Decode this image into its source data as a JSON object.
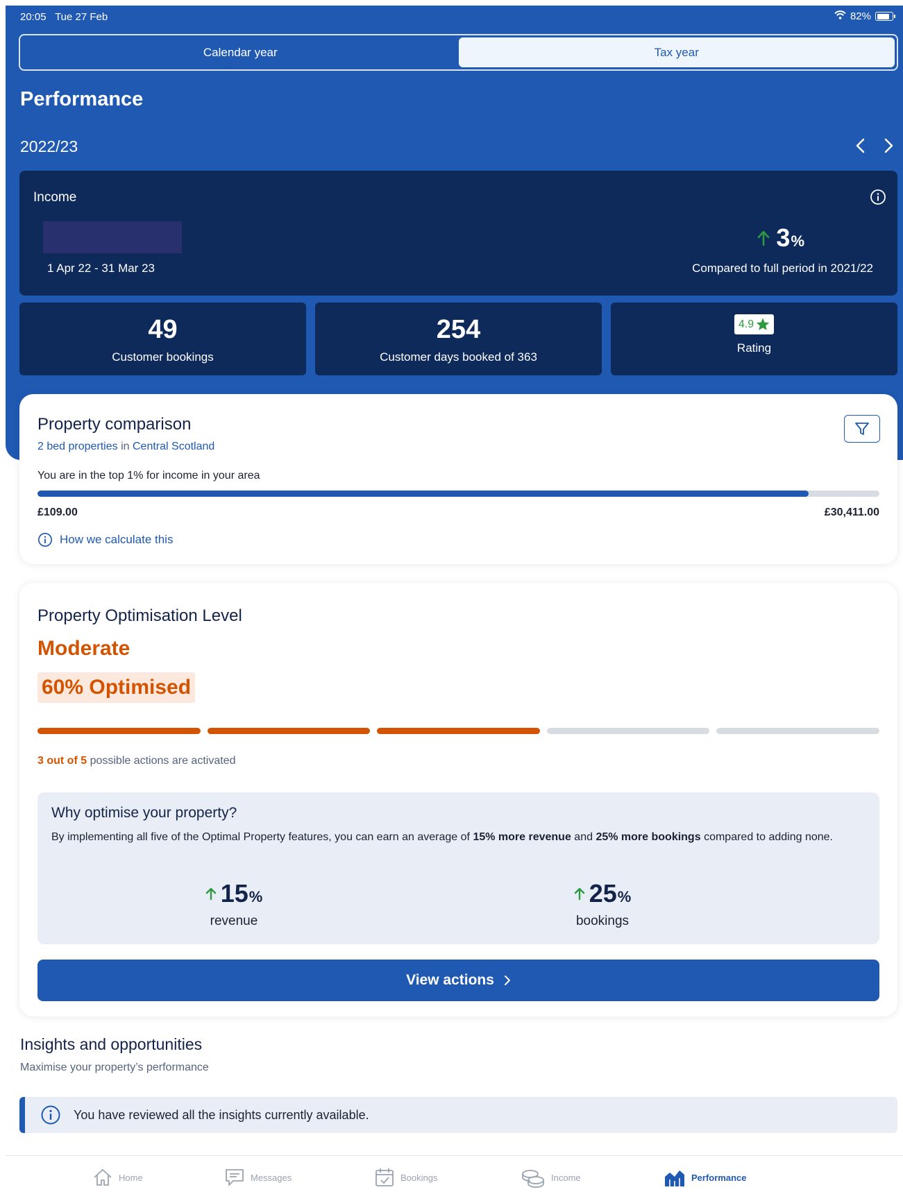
{
  "status_bar": {
    "time": "20:05",
    "date": "Tue 27 Feb",
    "battery": "82%"
  },
  "segmented": {
    "calendar_label": "Calendar year",
    "tax_label": "Tax year",
    "selected": "Tax year"
  },
  "page_title": "Performance",
  "period": {
    "label": "2022/23"
  },
  "income": {
    "label": "Income",
    "date_range": "1 Apr 22 - 31 Mar 23",
    "change_value": "3",
    "change_unit": "%",
    "change_direction": "up",
    "compared_text": "Compared to full period in 2021/22"
  },
  "stats": {
    "bookings_value": "49",
    "bookings_label": "Customer bookings",
    "days_value": "254",
    "days_label": "Customer days booked of 363",
    "rating_value": "4.9",
    "rating_label": "Rating"
  },
  "comparison": {
    "title": "Property comparison",
    "filter_beds": "2 bed properties",
    "filter_in": "in",
    "filter_area": "Central Scotland",
    "top_text": "You are in the top 1% for income in your area",
    "bar_fraction": 0.916,
    "min_label": "£109.00",
    "max_label": "£30,411.00",
    "help_link": "How we calculate this"
  },
  "optimisation": {
    "title": "Property Optimisation Level",
    "level": "Moderate",
    "percent_text": "60% Optimised",
    "segments_total": 5,
    "segments_active": 3,
    "actions_bold": "3 out of 5",
    "actions_rest": "possible actions are activated",
    "why_title": "Why optimise your property?",
    "why_text_1": "By implementing all five of the Optimal Property features, you can earn an average of",
    "why_bold_1": "15% more revenue",
    "why_text_2": "and",
    "why_bold_2": "25% more bookings",
    "why_text_3": "compared to adding none.",
    "revenue_value": "15",
    "revenue_unit": "%",
    "revenue_label": "revenue",
    "bookings_value": "25",
    "bookings_unit": "%",
    "bookings_label": "bookings",
    "view_button": "View actions"
  },
  "insights": {
    "title": "Insights and opportunities",
    "subtitle": "Maximise your property’s performance",
    "notice": "You have reviewed all the insights currently available."
  },
  "tabbar": [
    {
      "label": "Home",
      "icon": "home-icon"
    },
    {
      "label": "Messages",
      "icon": "messages-icon"
    },
    {
      "label": "Bookings",
      "icon": "calendar-check-icon"
    },
    {
      "label": "Income",
      "icon": "coins-icon"
    },
    {
      "label": "Performance",
      "icon": "performance-chart-icon",
      "active": true
    }
  ],
  "colors": {
    "brand_blue": "#1f59b1",
    "navy": "#0e2a5b",
    "orange": "#d35400",
    "up_green": "#2c9b3f"
  }
}
